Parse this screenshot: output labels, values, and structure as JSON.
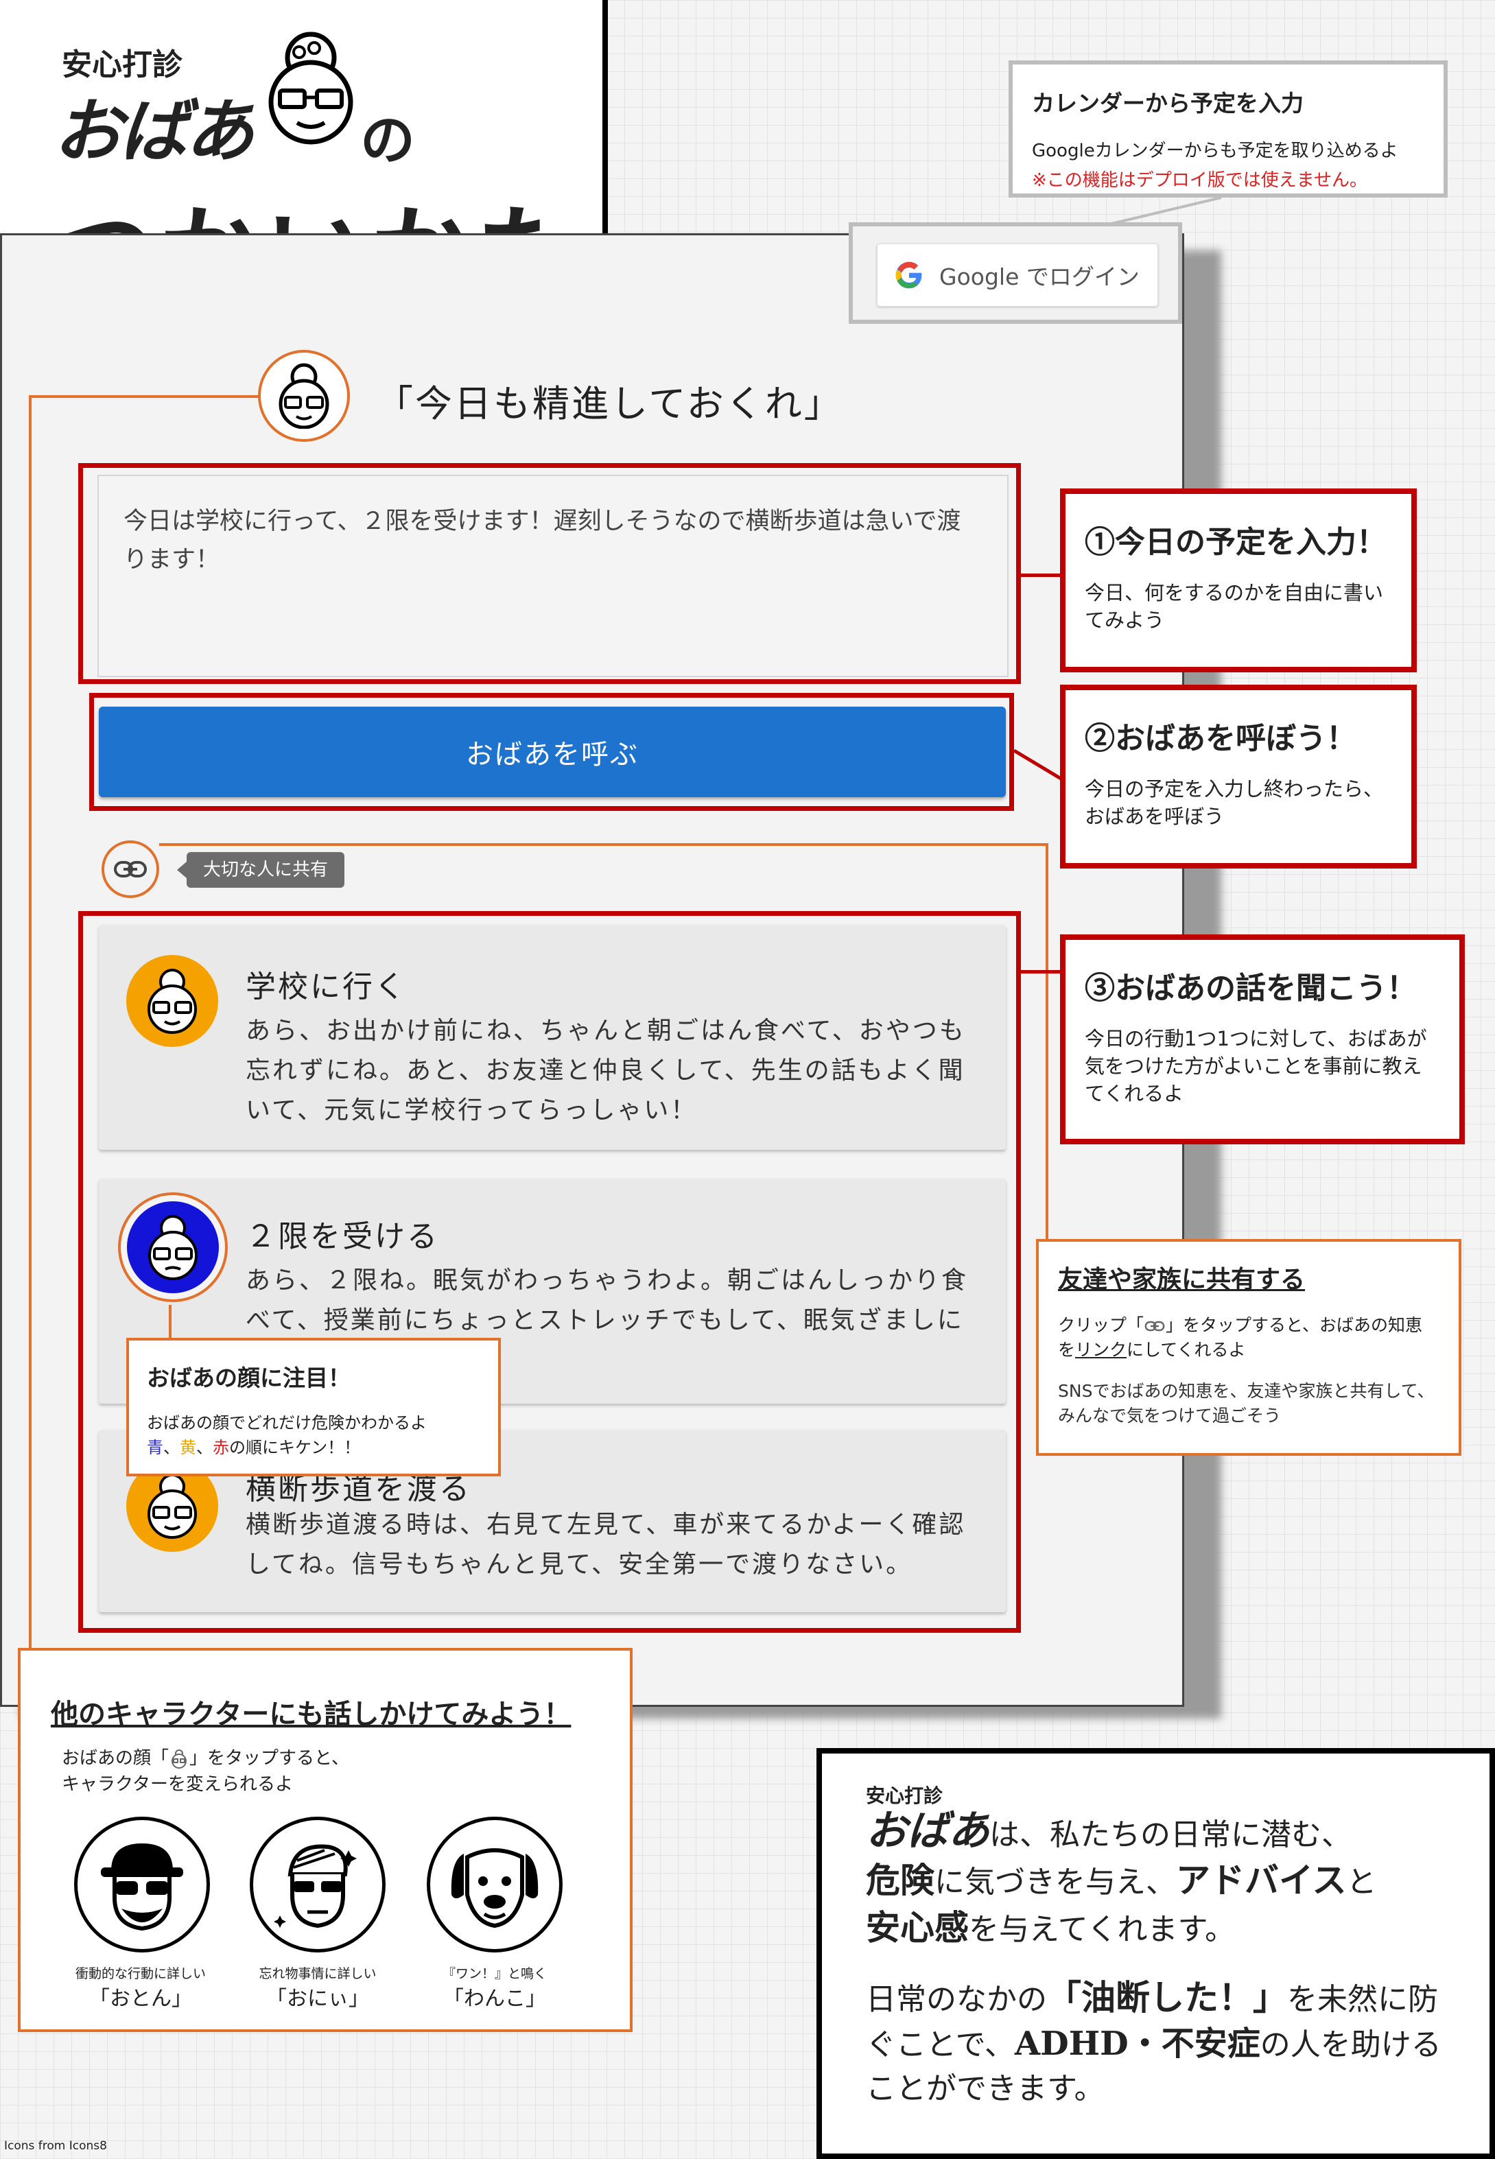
{
  "title": {
    "brand_small": "安心打診",
    "brand_name": "おばあ",
    "connector": "の",
    "heading": "つかいかた",
    "face_icon": "grandma-face-icon"
  },
  "calendar_callout": {
    "title": "カレンダーから予定を入力",
    "description": "Googleカレンダーからも予定を取り込めるよ",
    "warning": "※この機能はデプロイ版では使えません。",
    "warning_color": "#e02020"
  },
  "app": {
    "google_login": {
      "icon": "google-g-icon",
      "label": "Google でログイン"
    },
    "header_quote": "「今日も精進しておくれ」",
    "schedule_input": {
      "value": "今日は学校に行って、２限を受けます！遅刻しそうなので横断歩道は急いで渡ります！"
    },
    "call_button": {
      "label": "おばあを呼ぶ",
      "color": "#1e73cf"
    },
    "share": {
      "icon": "link-icon",
      "tooltip": "大切な人に共有"
    },
    "cards": [
      {
        "title": "学校に行く",
        "body": "あら、お出かけ前にね、ちゃんと朝ごはん食べて、おやつも忘れずにね。あと、お友達と仲良くして、先生の話もよく聞いて、元気に学校行ってらっしゃい！",
        "face_color": "#f5a100",
        "danger": "yellow"
      },
      {
        "title": "２限を受ける",
        "body": "あら、２限ね。眠気がわっちゃうわよ。朝ごはんしっかり食べて、授業前にちょっとストレッチでもして、眠気ざましに",
        "face_color": "#1414d8",
        "danger": "blue"
      },
      {
        "title": "横断歩道を渡る",
        "body": "横断歩道渡る時は、右見て左見て、車が来てるかよーく確認してね。信号もちゃんと見て、安全第一で渡りなさい。",
        "face_color": "#f5a100",
        "danger": "yellow"
      }
    ]
  },
  "annotations": {
    "step1": {
      "title": "①今日の予定を入力！",
      "desc": "今日、何をするのかを自由に書いてみよう"
    },
    "step2": {
      "title": "②おばあを呼ぼう！",
      "desc": "今日の予定を入力し終わったら、おばあを呼ぼう"
    },
    "step3": {
      "title": "③おばあの話を聞こう！",
      "desc": "今日の行動1つ1つに対して、おばあが気をつけた方がよいことを事前に教えてくれるよ"
    },
    "share": {
      "title": "友達や家族に共有する",
      "desc1_a": "クリップ「",
      "desc1_b": "」をタップすると、おばあの知恵を",
      "desc1_link": "リンク",
      "desc1_c": "にしてくれるよ",
      "desc2": "SNSでおばあの知恵を、友達や家族と共有して、みんなで気をつけて過ごそう"
    },
    "face": {
      "title": "おばあの顔に注目！",
      "desc": "おばあの顔でどれだけ危険かわかるよ",
      "blue": "青",
      "sep1": "、",
      "yellow": "黄",
      "sep2": "、",
      "red": "赤",
      "tail": "の順にキケン！！",
      "colors": {
        "blue": "#2a2ae0",
        "yellow": "#e8a800",
        "red": "#e02020"
      }
    }
  },
  "characters": {
    "title": "他のキャラクターにも話しかけてみよう！",
    "desc_a": "おばあの顔「",
    "desc_b": "」をタップすると、",
    "desc_c": "キャラクターを変えられるよ",
    "items": [
      {
        "caption": "衝動的な行動に詳しい",
        "name": "「おとん」",
        "icon": "dad-cap-sunglasses-icon"
      },
      {
        "caption": "忘れ物事情に詳しい",
        "name": "「おにぃ」",
        "icon": "brother-sparkle-icon"
      },
      {
        "caption": "『ワン！』と鳴く",
        "name": "「わんこ」",
        "icon": "dog-face-icon"
      }
    ]
  },
  "about": {
    "brand_small": "安心打診",
    "brand_name": "おばあ",
    "l1": "は、私たちの日常に潜む、",
    "l2_b": "危険",
    "l2": "に気づきを与え、",
    "l2_c": "アドバイス",
    "l2_d": "と",
    "l3_b": "安心感",
    "l3": "を与えてくれます。",
    "p2_a": "日常のなかの",
    "p2_b": "「油断した！」",
    "p2_c": "を未然に防ぐことで、",
    "p2_d": "ADHD・不安症",
    "p2_e": "の人を助けることができます。"
  },
  "footer": "Icons from Icons8"
}
